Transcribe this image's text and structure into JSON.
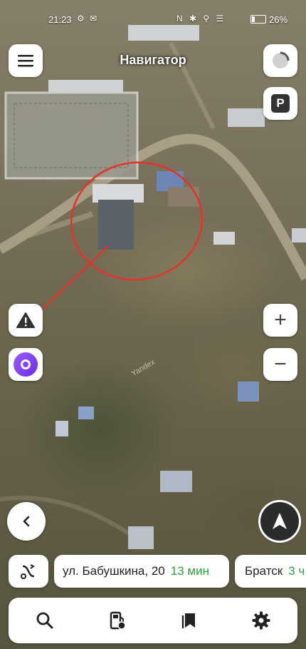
{
  "status_bar": {
    "time": "21:23",
    "battery": "26%"
  },
  "header": {
    "title": "Навигатор"
  },
  "map": {
    "watermark": "Yandex"
  },
  "controls": {
    "parking_label": "P",
    "zoom_in": "+",
    "zoom_out": "−"
  },
  "route_bar": {
    "destinations": [
      {
        "address": "ул. Бабушкина, 20",
        "time": "13 мин"
      },
      {
        "address": "Братск",
        "time": "3 ч"
      }
    ]
  },
  "bottom_toolbar": {
    "items": [
      {
        "icon": "search-icon"
      },
      {
        "icon": "fuel-icon"
      },
      {
        "icon": "bookmark-icon"
      },
      {
        "icon": "gear-icon"
      }
    ]
  },
  "colors": {
    "accent_green": "#2ea043",
    "alice_purple": "#7b3cf0",
    "annotation_red": "#e5322d"
  }
}
